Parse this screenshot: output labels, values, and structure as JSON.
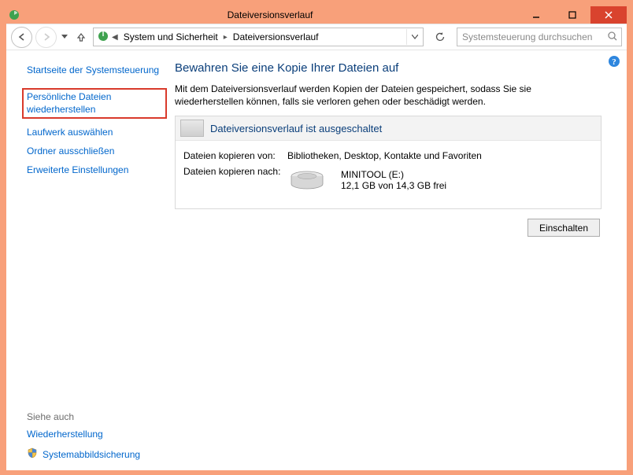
{
  "window": {
    "title": "Dateiversionsverlauf"
  },
  "breadcrumb": {
    "item1": "System und Sicherheit",
    "item2": "Dateiversionsverlauf"
  },
  "search": {
    "placeholder": "Systemsteuerung durchsuchen"
  },
  "sidebar": {
    "home": "Startseite der Systemsteuerung",
    "restore_line1": "Persönliche Dateien",
    "restore_line2": "wiederherstellen",
    "select_drive": "Laufwerk auswählen",
    "exclude_folders": "Ordner ausschließen",
    "advanced": "Erweiterte Einstellungen",
    "see_also": "Siehe auch",
    "recovery": "Wiederherstellung",
    "image_backup": "Systemabbildsicherung"
  },
  "main": {
    "heading": "Bewahren Sie eine Kopie Ihrer Dateien auf",
    "description": "Mit dem Dateiversionsverlauf werden Kopien der Dateien gespeichert, sodass Sie sie wiederherstellen können, falls sie verloren gehen oder beschädigt werden.",
    "panel_title": "Dateiversionsverlauf ist ausgeschaltet",
    "copy_from_label": "Dateien kopieren von:",
    "copy_from_value": "Bibliotheken, Desktop, Kontakte und Favoriten",
    "copy_to_label": "Dateien kopieren nach:",
    "drive_name": "MINITOOL (E:)",
    "drive_space": "12,1 GB von 14,3 GB frei",
    "enable_button": "Einschalten"
  }
}
